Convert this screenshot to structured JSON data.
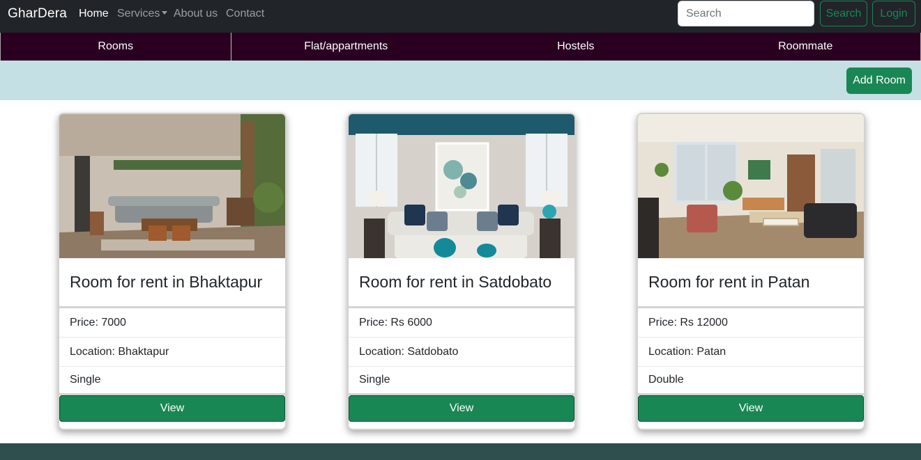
{
  "navbar": {
    "brand": "GharDera",
    "links": {
      "home": "Home",
      "services": "Services",
      "about": "About us",
      "contact": "Contact"
    },
    "search": {
      "placeholder": "Search",
      "button": "Search"
    },
    "login": "Login"
  },
  "categories": [
    "Rooms",
    "Flat/appartments",
    "Hostels",
    "Roommate"
  ],
  "actions": {
    "add_room": "Add Room"
  },
  "listings": [
    {
      "title": "Room for rent in Bhaktapur",
      "price": "Price: 7000",
      "location": "Location: Bhaktapur",
      "type": "Single",
      "button": "View"
    },
    {
      "title": "Room for rent in Satdobato",
      "price": "Price: Rs 6000",
      "location": "Location: Satdobato",
      "type": "Single",
      "button": "View"
    },
    {
      "title": "Room for rent in Patan",
      "price": "Price: Rs 12000",
      "location": "Location: Patan",
      "type": "Double",
      "button": "View"
    }
  ],
  "colors": {
    "navbar_bg": "#212529",
    "category_bg": "#2a0021",
    "action_strip_bg": "#c5e0e4",
    "primary_green": "#198754",
    "footer_bg": "#2f4f4f"
  }
}
